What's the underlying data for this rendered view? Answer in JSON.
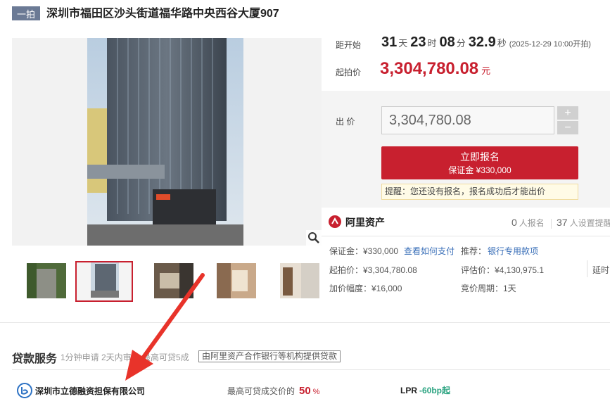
{
  "header": {
    "badge": "一拍",
    "title": "深圳市福田区沙头街道福华路中央西谷大厦907"
  },
  "countdown": {
    "label": "距开始",
    "days": "31",
    "days_unit": "天",
    "hours": "23",
    "hours_unit": "时",
    "minutes": "08",
    "minutes_unit": "分",
    "seconds": "32.9",
    "seconds_unit": "秒",
    "start_note": "(2025-12-29 10:00开拍)"
  },
  "starting_price": {
    "label": "起拍价",
    "value": "3,304,780.08",
    "unit": "元"
  },
  "bid": {
    "label": "出 价",
    "input_value": "3,304,780.08",
    "plus": "+",
    "minus": "−",
    "signup_label": "立即报名",
    "signup_deposit": "保证金 ¥330,000",
    "notice": "提醒：您还没有报名，报名成功后才能出价"
  },
  "platform": {
    "name": "阿里资产",
    "signup_count": "0",
    "signup_unit": "人报名",
    "reminder_count": "37",
    "reminder_unit": "人设置提醒"
  },
  "info": {
    "deposit": "保证金：¥330,000",
    "how_to_pay": "查看如何支付",
    "recommend_label": "推荐：",
    "recommend_link": "银行专用款项",
    "start_price": "起拍价：¥3,304,780.08",
    "appraisal": "评估价：¥4,130,975.1",
    "delay": "延时",
    "increment": "加价幅度：¥16,000",
    "cycle": "竞价周期：1天"
  },
  "loan": {
    "title": "贷款服务",
    "desc": "1分钟申请 2天内审核 最高可贷5成",
    "tag": "由阿里资产合作银行等机构提供贷款",
    "company": "深圳市立德融资担保有限公司",
    "ratio_label": "最高可贷成交价的",
    "ratio_value": "50",
    "ratio_unit": "%",
    "lpr_label": "LPR",
    "lpr_value": "-60bp起"
  },
  "colors": {
    "accent_red": "#c8202f",
    "link_blue": "#3a6fb8",
    "annotation_arrow": "#e8332a",
    "lpr_green": "#2aa380"
  },
  "icons": {
    "zoom": "magnifier-icon",
    "platform": "alibaba-asset-logo",
    "company": "company-logo"
  }
}
